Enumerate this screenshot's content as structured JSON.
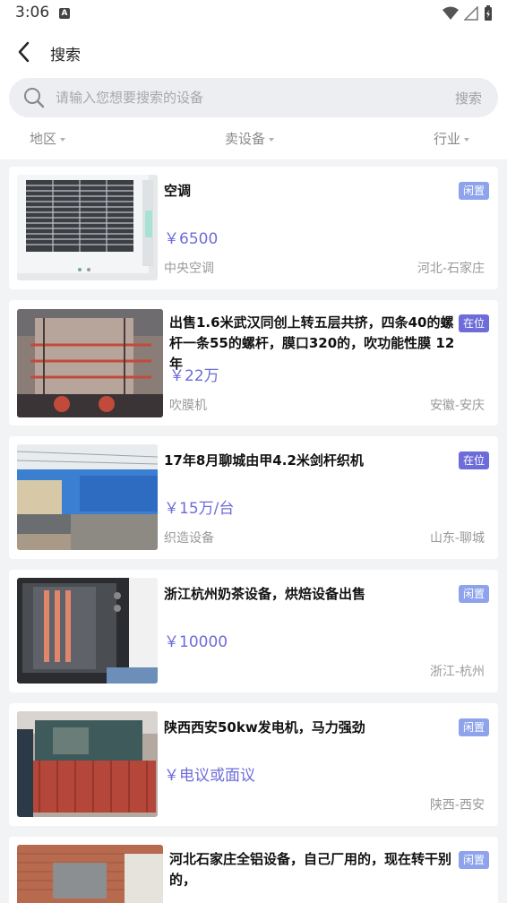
{
  "status_bar": {
    "time": "3:06",
    "notification_icon": "A"
  },
  "header": {
    "title": "搜索",
    "search": {
      "placeholder": "请输入您想要搜索的设备",
      "button_label": "搜索"
    },
    "filters": [
      {
        "label": "地区"
      },
      {
        "label": "卖设备"
      },
      {
        "label": "行业"
      }
    ]
  },
  "listings": [
    {
      "title": "空调",
      "price": "￥6500",
      "category": "中央空调",
      "location": "河北-石家庄",
      "badge": "闲置"
    },
    {
      "title": "出售1.6米武汉同创上转五层共挤，四条40的螺杆一条55的螺杆，膜口320的，吹功能性膜 12年",
      "price": "￥22万",
      "category": "吹膜机",
      "location": "安徽-安庆",
      "badge": "在位"
    },
    {
      "title": "17年8月聊城由甲4.2米剑杆织机",
      "price": "￥15万/台",
      "category": "织造设备",
      "location": "山东-聊城",
      "badge": "在位"
    },
    {
      "title": "浙江杭州奶茶设备，烘焙设备出售",
      "price": "￥10000",
      "category": "",
      "location": "浙江-杭州",
      "badge": "闲置"
    },
    {
      "title": "陕西西安50kw发电机，马力强劲",
      "price": "￥电议或面议",
      "category": "",
      "location": "陕西-西安",
      "badge": "闲置"
    },
    {
      "title": "河北石家庄全铝设备，自己厂用的，现在转干别的，",
      "price": "",
      "category": "",
      "location": "",
      "badge": "闲置"
    }
  ]
}
